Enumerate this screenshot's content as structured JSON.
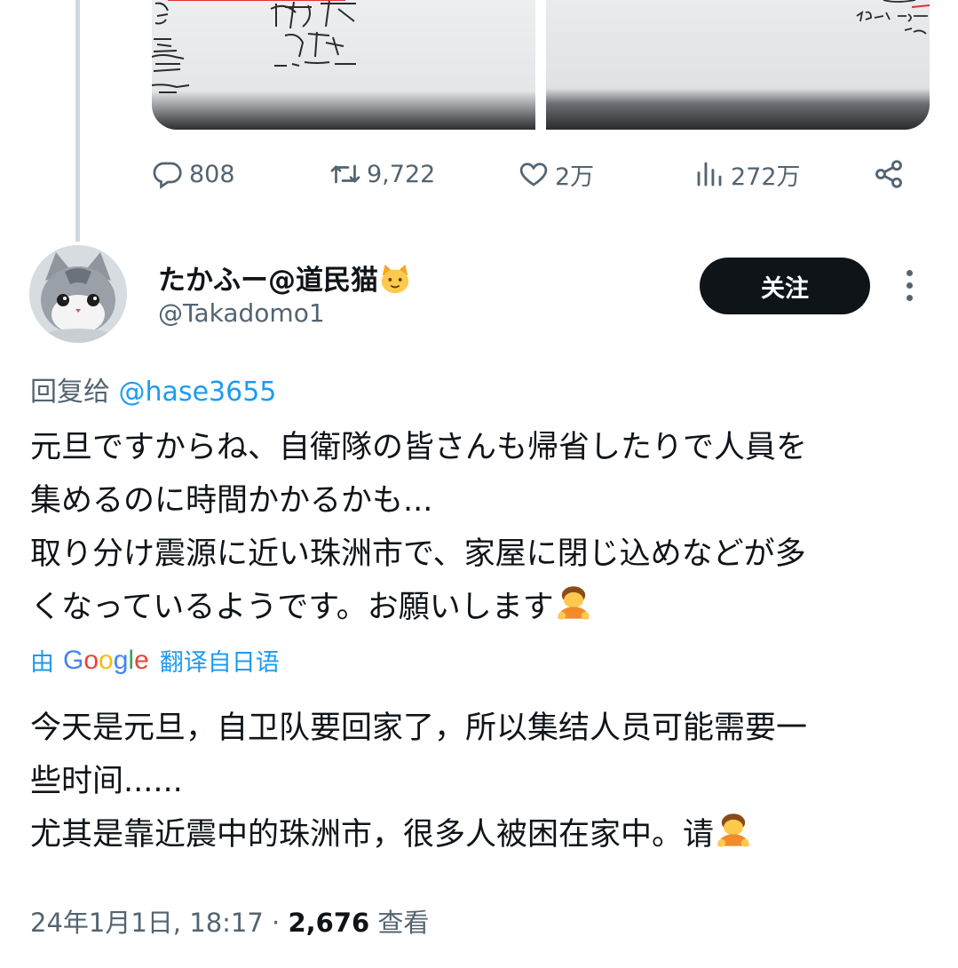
{
  "tweet_top": {
    "stats": {
      "replies": "808",
      "retweets": "9,722",
      "likes": "2万",
      "views": "272万"
    }
  },
  "reply": {
    "display_name": "たかふー@道民猫",
    "name_emoji": "🐱",
    "handle": "@Takadomo1",
    "follow_label": "关注",
    "reply_to_prefix": "回复给 ",
    "reply_to_handle": "@hase3655",
    "original_text": "元旦ですからね、自衛隊の皆さんも帰省したりで人員を\n集めるのに時間かかるかも...\n取り分け震源に近い珠洲市で、家屋に閉じ込めなどが多\nくなっているようです。お願いします",
    "translated_by_prefix": "由",
    "translated_by_brand": [
      "G",
      "o",
      "o",
      "g",
      "l",
      "e"
    ],
    "translated_by_suffix": "翻译自日语",
    "translated_text": "今天是元旦，自卫队要回家了，所以集结人员可能需要一\n些时间......\n尤其是靠近震中的珠洲市，很多人被困在家中。请",
    "timestamp": "24年1月1日, 18:17 · ",
    "view_count": "2,676",
    "view_label": " 查看"
  },
  "icons": {
    "reply": "reply-icon",
    "retweet": "retweet-icon",
    "like": "heart-icon",
    "views": "views-chart-icon",
    "share": "share-icon",
    "more": "more-vertical-icon",
    "bow": "person-bowing-emoji"
  },
  "colors": {
    "accent": "#1d9bf0",
    "muted": "#536471",
    "text": "#0f1419",
    "follow_bg": "#0f1419"
  }
}
